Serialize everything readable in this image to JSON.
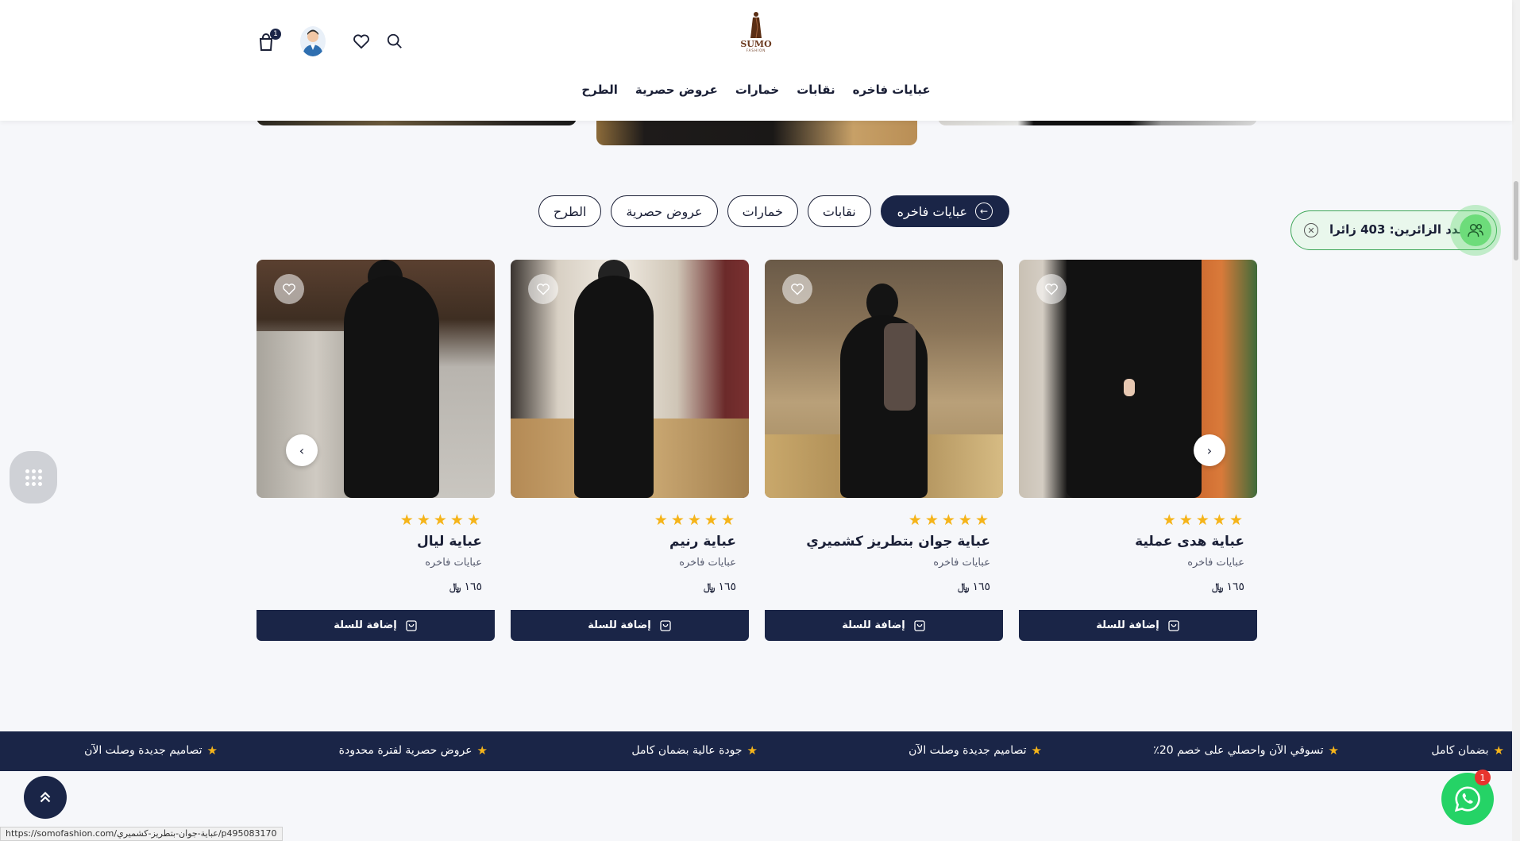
{
  "header": {
    "logo_text": "SUMO",
    "logo_sub": "FASHION",
    "cart_count": "1",
    "nav": [
      "عبايات فاخره",
      "نقابات",
      "خمارات",
      "عروض حصرية",
      "الطرح"
    ]
  },
  "tabs": [
    {
      "label": "عبايات فاخره",
      "active": true
    },
    {
      "label": "نقابات",
      "active": false
    },
    {
      "label": "خمارات",
      "active": false
    },
    {
      "label": "عروض حصرية",
      "active": false
    },
    {
      "label": "الطرح",
      "active": false
    }
  ],
  "products": [
    {
      "title": "عباية هدى عملية",
      "category": "عبايات فاخره",
      "price": "١٦٥",
      "rating": 5,
      "add_label": "إضافة للسلة"
    },
    {
      "title": "عباية جوان بتطريز كشميري",
      "category": "عبايات فاخره",
      "price": "١٦٥",
      "rating": 5,
      "add_label": "إضافة للسلة"
    },
    {
      "title": "عباية رنيم",
      "category": "عبايات فاخره",
      "price": "١٦٥",
      "rating": 5,
      "add_label": "إضافة للسلة"
    },
    {
      "title": "عباية ليال",
      "category": "عبايات فاخره",
      "price": "١٦٥",
      "rating": 5,
      "add_label": "إضافة للسلة"
    }
  ],
  "currency_symbol": "﷼",
  "visitors": {
    "text": "عدد الزائرين: 403 زائرا"
  },
  "marquee": [
    "بضمان كامل",
    "تسوقي الآن واحصلي على خصم 20٪",
    "تصاميم جديدة وصلت الآن",
    "جودة عالية بضمان كامل",
    "عروض حصرية لفترة محدودة",
    "تصاميم جديدة وصلت الآن"
  ],
  "whatsapp_badge": "1",
  "status_url": "https://somofashion.com/عباية-جوان-بتطريز-كشميري/p495083170",
  "colors": {
    "brand": "#1a2547",
    "star": "#f5b41a",
    "visitors_green": "#3da657",
    "whatsapp": "#25d366"
  },
  "icons": [
    "search-icon",
    "heart-icon",
    "avatar",
    "cart-icon",
    "arrow-left-icon",
    "chevron-right-icon",
    "chevron-left-icon",
    "close-circle-icon",
    "users-icon",
    "grid-icon",
    "chevrons-up-icon",
    "whatsapp-icon"
  ]
}
